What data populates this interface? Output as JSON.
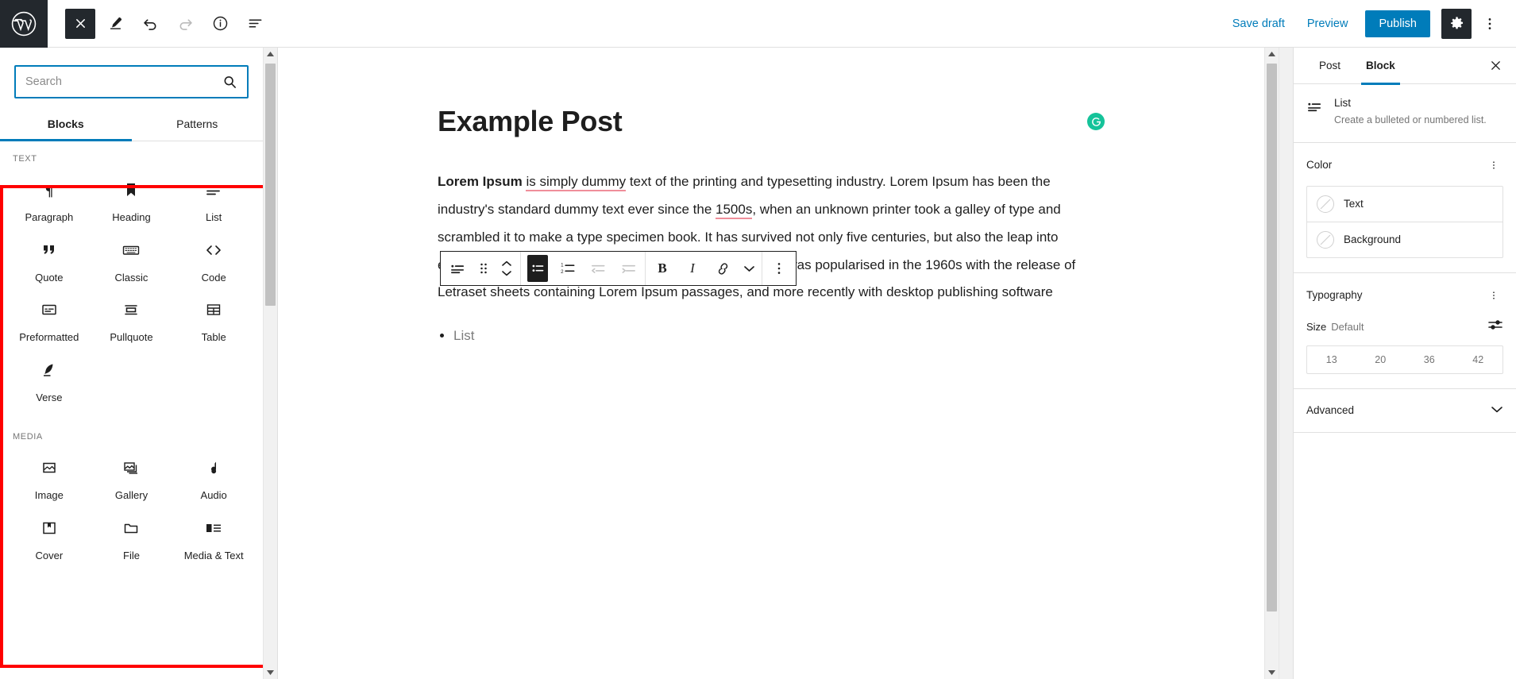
{
  "header": {
    "logo_icon": "wordpress-logo-icon",
    "close_icon": "close-icon",
    "edit_icon": "pencil-icon",
    "undo_icon": "undo-icon",
    "redo_icon": "redo-icon",
    "info_icon": "info-icon",
    "list_view_icon": "list-view-icon",
    "save_draft_label": "Save draft",
    "preview_label": "Preview",
    "publish_label": "Publish",
    "settings_icon": "gear-icon",
    "more_icon": "kebab-menu-icon",
    "accent_color": "#007cba",
    "dark_color": "#23282d"
  },
  "inserter": {
    "search": {
      "value": "",
      "placeholder": "Search",
      "icon": "search-icon"
    },
    "tabs": [
      {
        "label": "Blocks",
        "active": true
      },
      {
        "label": "Patterns",
        "active": false
      }
    ],
    "sections": [
      {
        "title": "TEXT",
        "blocks": [
          {
            "label": "Paragraph",
            "icon": "paragraph-icon"
          },
          {
            "label": "Heading",
            "icon": "heading-bookmark-icon"
          },
          {
            "label": "List",
            "icon": "list-icon"
          },
          {
            "label": "Quote",
            "icon": "quote-icon"
          },
          {
            "label": "Classic",
            "icon": "keyboard-icon"
          },
          {
            "label": "Code",
            "icon": "code-brackets-icon"
          },
          {
            "label": "Preformatted",
            "icon": "preformatted-icon"
          },
          {
            "label": "Pullquote",
            "icon": "pullquote-icon"
          },
          {
            "label": "Table",
            "icon": "table-icon"
          },
          {
            "label": "Verse",
            "icon": "verse-quill-icon"
          }
        ]
      },
      {
        "title": "MEDIA",
        "blocks": [
          {
            "label": "Image",
            "icon": "image-icon"
          },
          {
            "label": "Gallery",
            "icon": "gallery-icon"
          },
          {
            "label": "Audio",
            "icon": "audio-note-icon"
          },
          {
            "label": "Cover",
            "icon": "cover-icon"
          },
          {
            "label": "File",
            "icon": "folder-icon"
          },
          {
            "label": "Media & Text",
            "icon": "media-text-icon"
          }
        ]
      }
    ],
    "highlight_color": "#ff0000"
  },
  "editor": {
    "post_title": "Example Post",
    "grammarly_icon": "grammarly-refresh-icon",
    "grammarly_color": "#15c39a",
    "paragraph": {
      "bold_lead": "Lorem Ipsum",
      "underlined_1": "is simply dummy",
      "segment_1": " text of the printing and typesetting industry. Lorem Ipsum has been the industry's standard dummy text ever since the ",
      "underlined_2": "1500s",
      "segment_2": ", when an unknown printer took a galley of type and scrambled it to make a type specimen book. It has survived not only five centuries, but also the leap into electronic typesetting, remaining essentially unchanged. It was popularised in the 1960s with the release of Letraset sheets containing Lorem Ipsum passages, and more recently with desktop publishing software",
      "underline_color": "#ef8e9a"
    },
    "list_item": "List",
    "toolbar": {
      "block_type_icon": "list-icon",
      "drag_icon": "drag-handle-icon",
      "mover_icon": "move-up-down-icon",
      "unordered_list_icon": "unordered-list-icon",
      "ordered_list_icon": "ordered-list-icon",
      "outdent_icon": "outdent-icon",
      "indent_icon": "indent-icon",
      "bold_label": "B",
      "italic_label": "I",
      "link_icon": "link-icon",
      "more_formats_icon": "chevron-down-icon",
      "options_icon": "kebab-menu-icon"
    }
  },
  "sidebar": {
    "tabs": [
      {
        "label": "Post",
        "active": false
      },
      {
        "label": "Block",
        "active": true
      }
    ],
    "close_icon": "close-icon",
    "block_card": {
      "icon": "list-icon",
      "title": "List",
      "description": "Create a bulleted or numbered list."
    },
    "color_panel": {
      "title": "Color",
      "kebab_icon": "kebab-menu-icon",
      "rows": [
        {
          "label": "Text",
          "swatch": "unset-swatch-icon"
        },
        {
          "label": "Background",
          "swatch": "unset-swatch-icon"
        }
      ]
    },
    "typography_panel": {
      "title": "Typography",
      "kebab_icon": "kebab-menu-icon",
      "size_label": "Size",
      "size_value": "Default",
      "size_settings_icon": "sliders-icon",
      "presets": [
        "13",
        "20",
        "36",
        "42"
      ]
    },
    "advanced": {
      "label": "Advanced",
      "chevron_icon": "chevron-down-icon"
    }
  }
}
